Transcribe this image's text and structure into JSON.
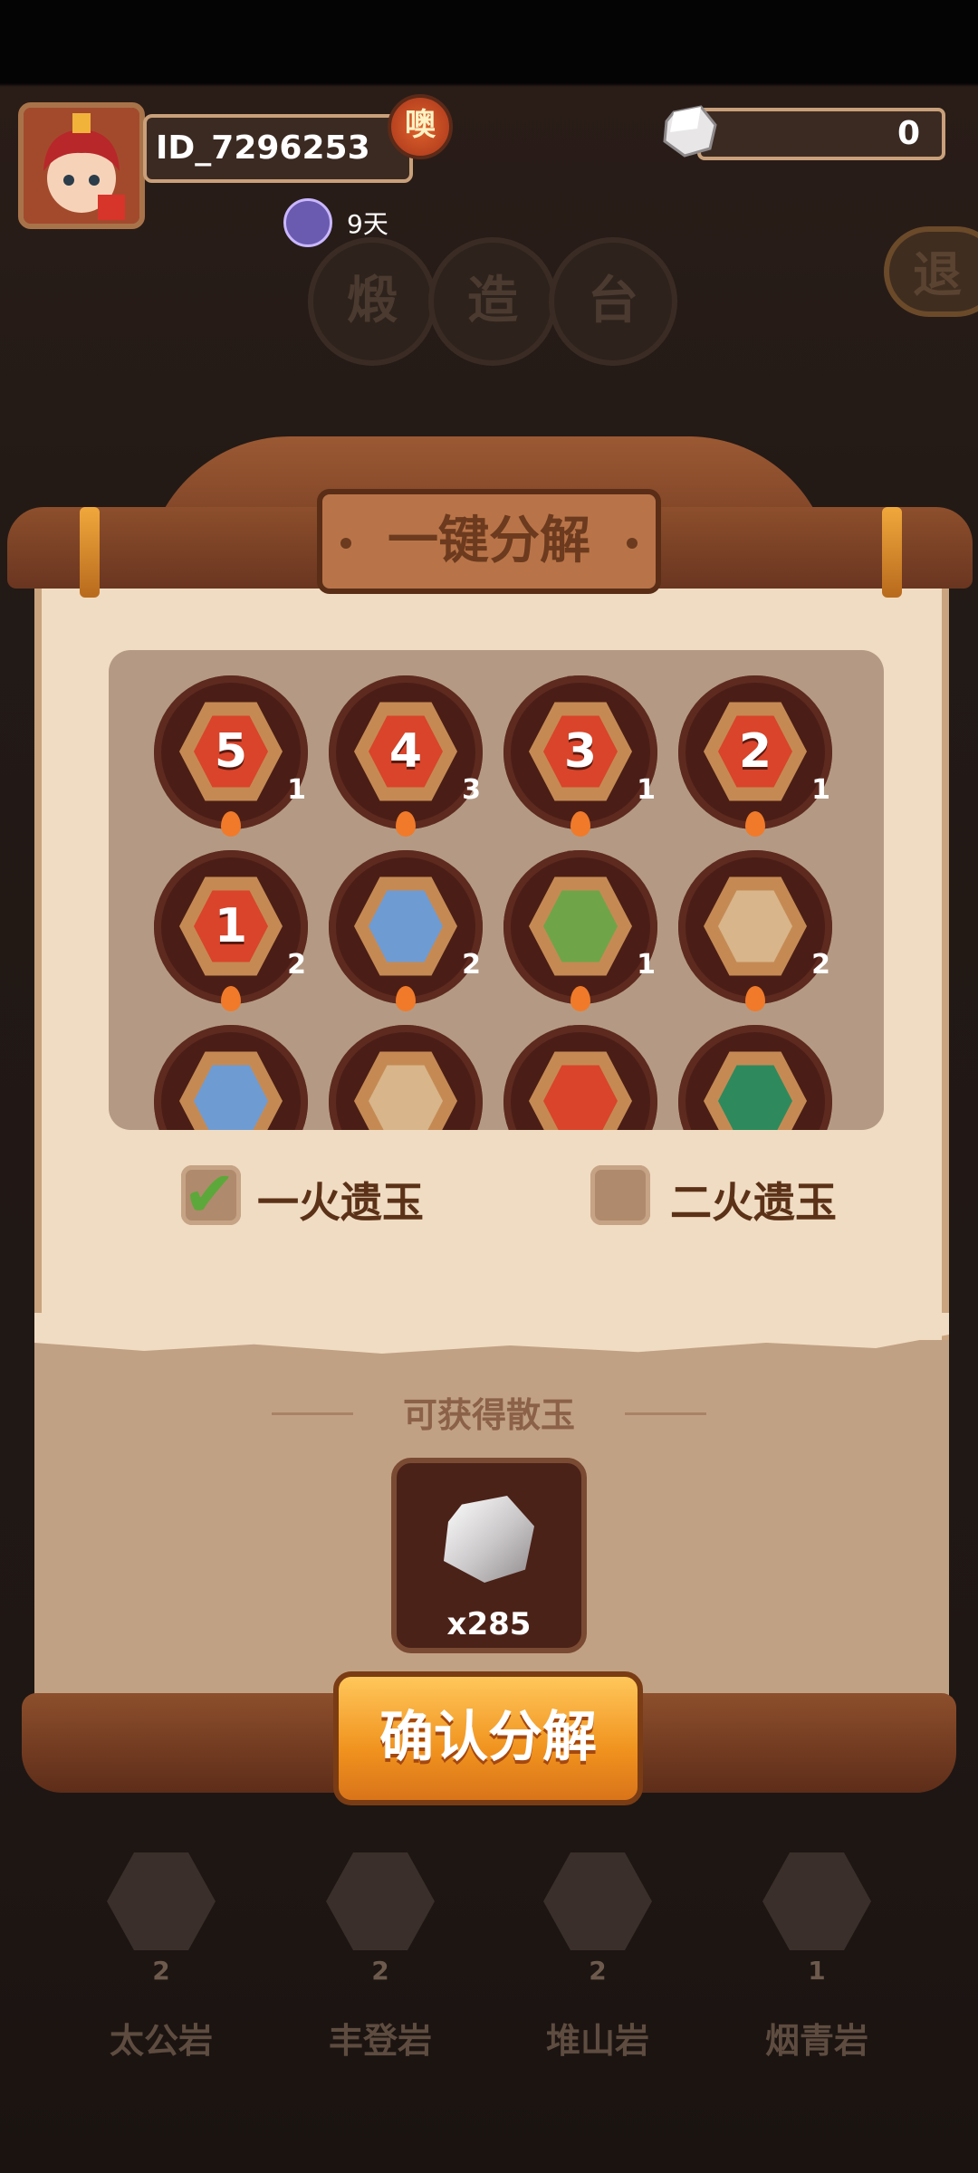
{
  "header": {
    "player_id": "ID_7296253",
    "badge_text": "噢",
    "days": "9天",
    "jade_count": "0"
  },
  "background": {
    "forge_chars": [
      "煅",
      "造",
      "台"
    ],
    "exit_label": "退",
    "bottom_items": [
      {
        "name": "太公岩",
        "count": "2"
      },
      {
        "name": "丰登岩",
        "count": "2"
      },
      {
        "name": "堆山岩",
        "count": "2"
      },
      {
        "name": "烟青岩",
        "count": "1"
      }
    ]
  },
  "modal": {
    "title": "一键分解",
    "items": [
      {
        "label": "5",
        "count": "1",
        "color": "#d9442a",
        "icon": "number"
      },
      {
        "label": "4",
        "count": "3",
        "color": "#d9442a",
        "icon": "number"
      },
      {
        "label": "3",
        "count": "1",
        "color": "#d9442a",
        "icon": "number"
      },
      {
        "label": "2",
        "count": "1",
        "color": "#d9442a",
        "icon": "number"
      },
      {
        "label": "1",
        "count": "2",
        "color": "#d9442a",
        "icon": "number"
      },
      {
        "label": "",
        "count": "2",
        "color": "#6f9bd3",
        "icon": "fish-icon"
      },
      {
        "label": "",
        "count": "1",
        "color": "#6fa548",
        "icon": "leaf-icon"
      },
      {
        "label": "",
        "count": "2",
        "color": "#d8b58a",
        "icon": "pot-icon"
      },
      {
        "label": "",
        "count": "",
        "color": "#6f9bd3",
        "icon": "fish-icon"
      },
      {
        "label": "",
        "count": "",
        "color": "#d8b58a",
        "icon": "pot-icon"
      },
      {
        "label": "",
        "count": "",
        "color": "#d9442a",
        "icon": "meat-icon"
      },
      {
        "label": "",
        "count": "",
        "color": "#2e8a5c",
        "icon": "scroll-icon"
      }
    ],
    "checkbox_1": {
      "label": "一火遗玉",
      "checked": true
    },
    "checkbox_2": {
      "label": "二火遗玉",
      "checked": false
    },
    "gain_title": "可获得散玉",
    "reward_count": "x285",
    "confirm_label": "确认分解"
  }
}
